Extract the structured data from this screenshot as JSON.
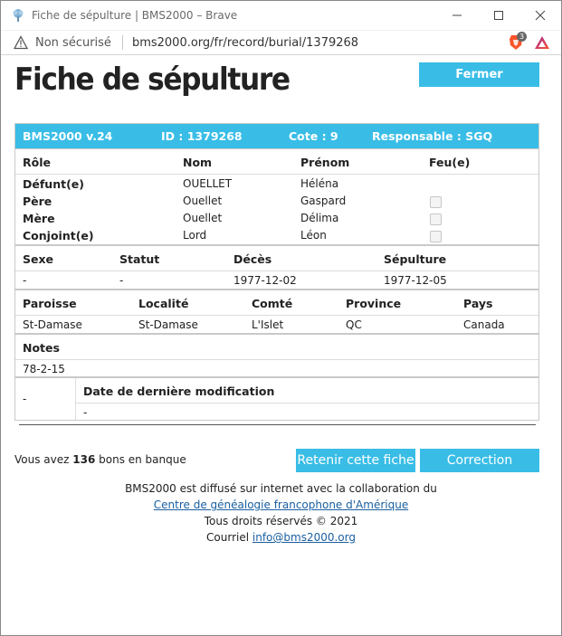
{
  "window": {
    "title": "Fiche de sépulture | BMS2000 – Brave"
  },
  "address": {
    "security": "Non sécurisé",
    "url": "bms2000.org/fr/record/burial/1379268",
    "brave_count": "3"
  },
  "page": {
    "title": "Fiche de sépulture",
    "close_label": "Fermer"
  },
  "record": {
    "header": {
      "version": "BMS2000 v.24",
      "id": "ID : 1379268",
      "cote": "Cote : 9",
      "responsable": "Responsable : SGQ"
    },
    "persons": {
      "headers": [
        "Rôle",
        "Nom",
        "Prénom",
        "Feu(e)"
      ],
      "rows": [
        {
          "role": "Défunt(e)",
          "nom": "OUELLET",
          "prenom": "Héléna",
          "feu": null
        },
        {
          "role": "Père",
          "nom": "Ouellet",
          "prenom": "Gaspard",
          "feu": false
        },
        {
          "role": "Mère",
          "nom": "Ouellet",
          "prenom": "Délima",
          "feu": false
        },
        {
          "role": "Conjoint(e)",
          "nom": "Lord",
          "prenom": "Léon",
          "feu": false
        }
      ]
    },
    "status": {
      "headers": [
        "Sexe",
        "Statut",
        "Décès",
        "Sépulture"
      ],
      "values": [
        "-",
        "-",
        "1977-12-02",
        "1977-12-05"
      ]
    },
    "place": {
      "headers": [
        "Paroisse",
        "Localité",
        "Comté",
        "Province",
        "Pays"
      ],
      "values": [
        "St-Damase",
        "St-Damase",
        "L'Islet",
        "QC",
        "Canada"
      ]
    },
    "notes": {
      "header": "Notes",
      "value": "78-2-15"
    },
    "modification": {
      "left_value": "-",
      "header": "Date de dernière modification",
      "value": "-"
    }
  },
  "actions": {
    "bons_prefix": "Vous avez ",
    "bons_count": "136",
    "bons_suffix": " bons en banque",
    "retain_label": "Retenir cette fiche",
    "correction_label": "Correction"
  },
  "footer": {
    "line1": "BMS2000 est diffusé sur internet avec la collaboration du",
    "link1": "Centre de généalogie francophone d'Amérique",
    "line3": "Tous droits réservés © 2021",
    "email_prefix": "Courriel ",
    "email": "info@bms2000.org"
  },
  "colors": {
    "accent": "#39bde6",
    "link": "#1a5fa0",
    "warning_icon": "#555555",
    "brave_icon": "#fb542b"
  },
  "icons": {
    "app": "tree-icon",
    "security": "warning-triangle-icon",
    "brave": "brave-lion-icon",
    "rewards": "brave-rewards-triangle-icon"
  }
}
